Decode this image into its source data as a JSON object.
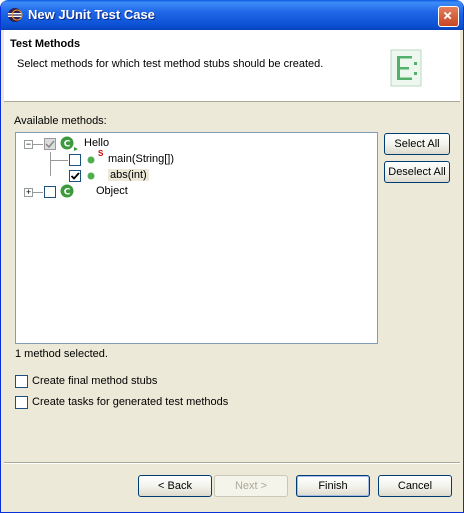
{
  "window": {
    "title": "New JUnit Test Case"
  },
  "header": {
    "title": "Test Methods",
    "description": "Select methods for which test method stubs should be created."
  },
  "methods_label": "Available methods:",
  "tree": [
    {
      "label": "Hello",
      "expander": "−",
      "checked": "partial"
    },
    {
      "label": "main(String[])",
      "checked": false,
      "static_marker": "S"
    },
    {
      "label": "abs(int)",
      "checked": true
    },
    {
      "label": "Object",
      "expander": "+",
      "checked": false
    }
  ],
  "side_buttons": {
    "select_all": "Select All",
    "deselect_all": "Deselect All"
  },
  "status": "1 method selected.",
  "options": [
    {
      "label": "Create final method stubs",
      "checked": false
    },
    {
      "label": "Create tasks for generated test methods",
      "checked": false
    }
  ],
  "footer_buttons": {
    "back": "< Back",
    "next": "Next >",
    "finish": "Finish",
    "cancel": "Cancel"
  },
  "colors": {
    "titlebar": "#0a4fd1",
    "dialog_bg": "#ece9d8",
    "class_icon": "#3c9a3c",
    "method_icon": "#4caf50"
  }
}
